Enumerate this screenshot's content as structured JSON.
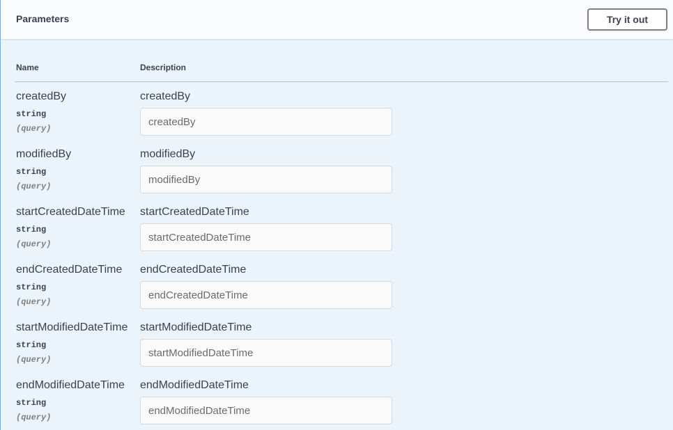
{
  "section": {
    "title": "Parameters",
    "try_it_out_label": "Try it out"
  },
  "columns": {
    "name": "Name",
    "description": "Description"
  },
  "parameters": [
    {
      "name": "createdBy",
      "type": "string",
      "in": "(query)",
      "description": "createdBy",
      "placeholder": "createdBy",
      "value": ""
    },
    {
      "name": "modifiedBy",
      "type": "string",
      "in": "(query)",
      "description": "modifiedBy",
      "placeholder": "modifiedBy",
      "value": ""
    },
    {
      "name": "startCreatedDateTime",
      "type": "string",
      "in": "(query)",
      "description": "startCreatedDateTime",
      "placeholder": "startCreatedDateTime",
      "value": ""
    },
    {
      "name": "endCreatedDateTime",
      "type": "string",
      "in": "(query)",
      "description": "endCreatedDateTime",
      "placeholder": "endCreatedDateTime",
      "value": ""
    },
    {
      "name": "startModifiedDateTime",
      "type": "string",
      "in": "(query)",
      "description": "startModifiedDateTime",
      "placeholder": "startModifiedDateTime",
      "value": ""
    },
    {
      "name": "endModifiedDateTime",
      "type": "string",
      "in": "(query)",
      "description": "endModifiedDateTime",
      "placeholder": "endModifiedDateTime",
      "value": ""
    }
  ],
  "colors": {
    "background": "#ebf3fb",
    "accent_border": "#61affe",
    "text": "#3b4151",
    "muted": "#808080"
  }
}
